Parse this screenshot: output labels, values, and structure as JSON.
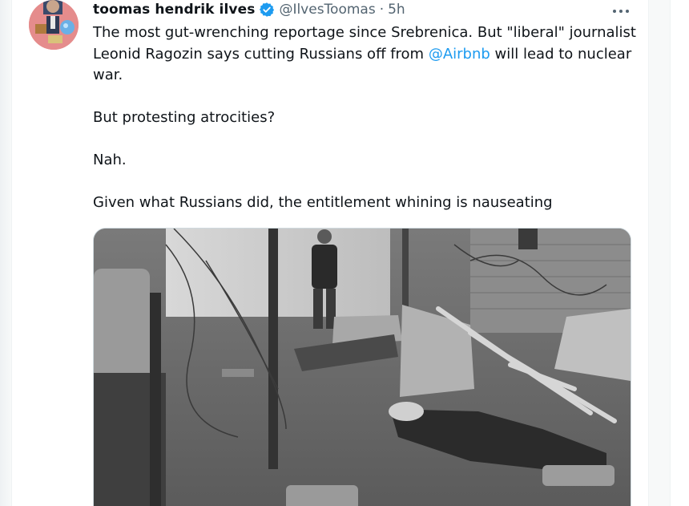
{
  "tweet": {
    "author_name": "toomas hendrik ilves",
    "handle": "@IlvesToomas",
    "separator": "·",
    "time": "5h",
    "more_label": "More",
    "text_line1_a": "The most gut-wrenching reportage since Srebrenica. But \"liberal\" journalist Leonid Ragozin says cutting Russians off from ",
    "mention": "@Airbnb",
    "text_line1_b": " will lead to nuclear war.",
    "para2": "But protesting atrocities?",
    "para3": "Nah.",
    "para4": "Given what Russians did, the entitlement whining is nauseating"
  },
  "colors": {
    "link": "#1d9bf0",
    "verified": "#1d9bf0",
    "text": "#0f1419",
    "muted": "#536471"
  },
  "icons": {
    "verified": "verified-badge-icon",
    "more": "more-dots-icon"
  }
}
